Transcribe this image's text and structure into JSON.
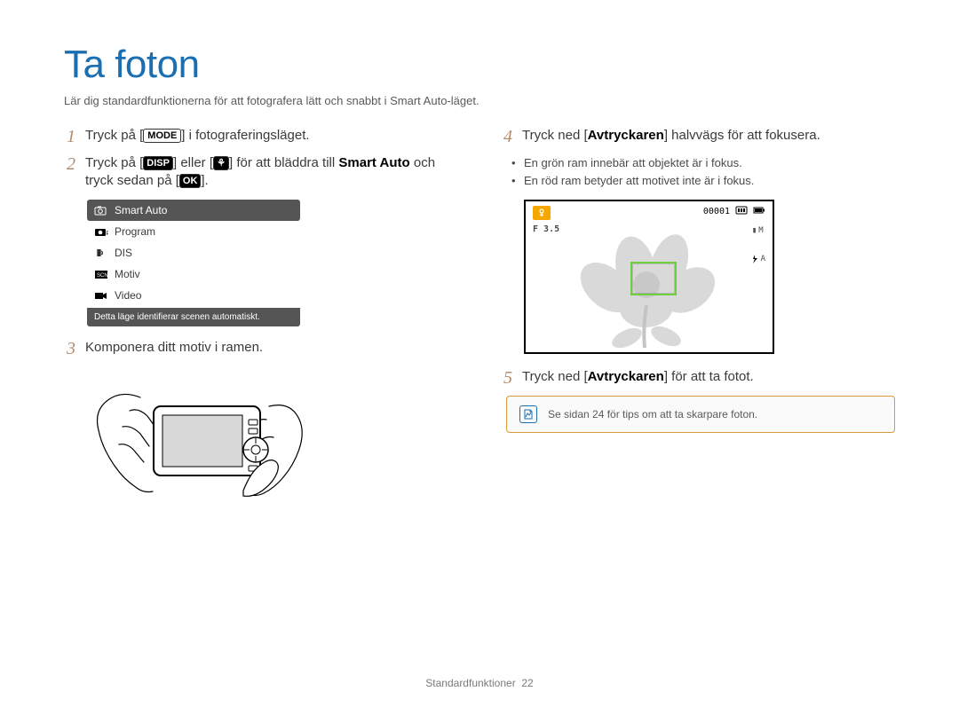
{
  "title": "Ta foton",
  "subtitle": "Lär dig standardfunktionerna för att fotografera lätt och snabbt i Smart Auto-läget.",
  "steps": {
    "1": {
      "pre": "Tryck på [",
      "btn": "MODE",
      "post": "] i fotograferingsläget."
    },
    "2": {
      "pre": "Tryck på [",
      "btn1": "DISP",
      "mid1": "] eller [",
      "btn2": "⚘",
      "mid2": "] för att bläddra till ",
      "bold": "Smart Auto",
      "post1": " och tryck sedan på [",
      "btn3": "OK",
      "post2": "]."
    },
    "3": {
      "text": "Komponera ditt motiv i ramen."
    },
    "4": {
      "pre": "Tryck ned [",
      "bold": "Avtryckaren",
      "post": "] halvvägs för att fokusera."
    },
    "bullets": [
      "En grön ram innebär att objektet är i fokus.",
      "En röd ram betyder att motivet inte är i fokus."
    ],
    "5": {
      "pre": "Tryck ned [",
      "bold": "Avtryckaren",
      "post": "] för att ta fotot."
    }
  },
  "menu": {
    "items": [
      {
        "label": "Smart Auto",
        "selected": true
      },
      {
        "label": "Program"
      },
      {
        "label": "DIS"
      },
      {
        "label": "Motiv"
      },
      {
        "label": "Video"
      }
    ],
    "caption": "Detta läge identifierar scenen automatiskt."
  },
  "lcd": {
    "counter": "00001",
    "fnumber": "F 3.5",
    "res": "M",
    "flash": "A"
  },
  "note": "Se sidan 24 för tips om att ta skarpare foton.",
  "footer": {
    "label": "Standardfunktioner",
    "page": "22"
  }
}
